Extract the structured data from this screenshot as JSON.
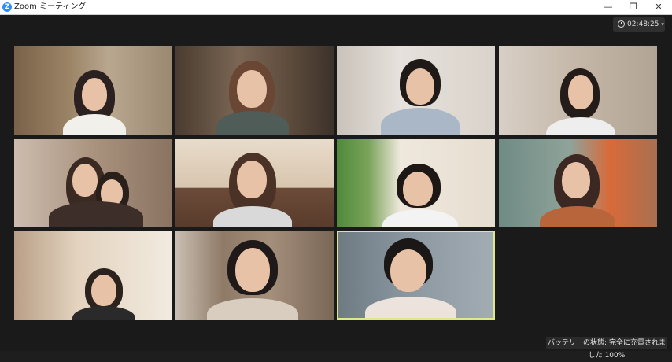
{
  "window": {
    "title": "Zoom ミーティング",
    "logo": "Z",
    "minimize": "—",
    "restore": "❐",
    "close": "✕"
  },
  "timer": {
    "elapsed": "02:48:25",
    "dropdown": "▾"
  },
  "status_bar": {
    "battery_text": "バッテリーの状態: 完全に充電されました 100%"
  },
  "participants": [
    {
      "bg": "#8a7358"
    },
    {
      "bg": "#6e5a4a"
    },
    {
      "bg": "#d9d4cf"
    },
    {
      "bg": "#cfc6bc"
    },
    {
      "bg": "#b39c86"
    },
    {
      "bg": "#d8c7b2"
    },
    {
      "bg": "#e4ddd2"
    },
    {
      "bg": "#6f8a84"
    },
    {
      "bg": "#d7c2ac"
    },
    {
      "bg": "#a99c8f"
    },
    {
      "bg": "#7f8a92"
    }
  ]
}
